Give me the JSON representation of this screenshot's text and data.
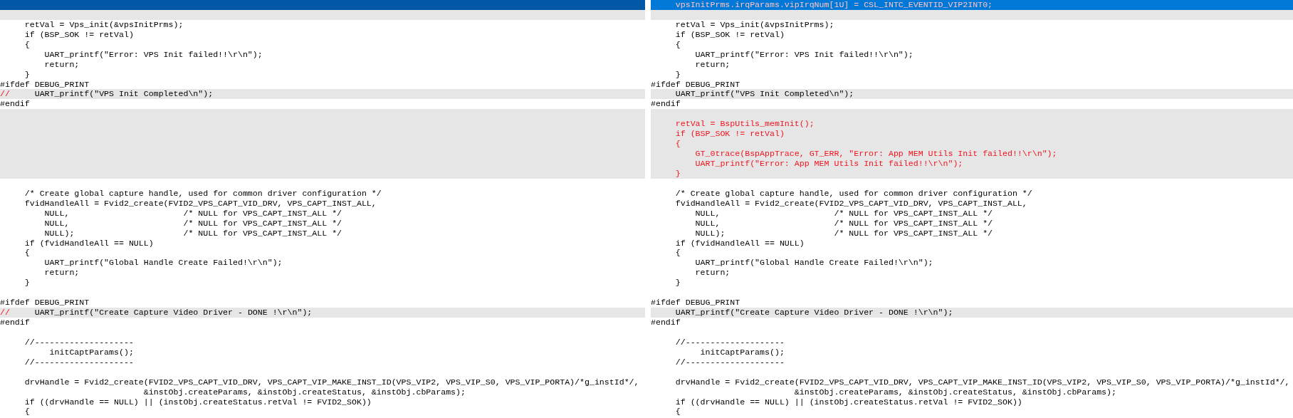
{
  "panes": [
    {
      "focused": false,
      "lines": [
        {
          "kind": "blank",
          "selected": true
        },
        {
          "kind": "blank",
          "selected": false
        },
        {
          "kind": "same",
          "selected": false,
          "text": "     retVal = Vps_init(&vpsInitPrms);"
        },
        {
          "kind": "same",
          "selected": false,
          "text": "     if (BSP_SOK != retVal)"
        },
        {
          "kind": "same",
          "selected": false,
          "text": "     {"
        },
        {
          "kind": "same",
          "selected": false,
          "text": "         UART_printf(\"Error: VPS Init failed!!\\r\\n\");"
        },
        {
          "kind": "same",
          "selected": false,
          "text": "         return;"
        },
        {
          "kind": "same",
          "selected": false,
          "text": "     }"
        },
        {
          "kind": "same",
          "selected": false,
          "text": "#ifdef DEBUG_PRINT"
        },
        {
          "kind": "changed",
          "selected": false,
          "prefix": "//",
          "text": "     UART_printf(\"VPS Init Completed\\n\");"
        },
        {
          "kind": "same",
          "selected": false,
          "text": "#endif"
        },
        {
          "kind": "blank",
          "selected": false
        },
        {
          "kind": "blank",
          "selected": false
        },
        {
          "kind": "blank",
          "selected": false
        },
        {
          "kind": "blank",
          "selected": false
        },
        {
          "kind": "blank",
          "selected": false
        },
        {
          "kind": "blank",
          "selected": false
        },
        {
          "kind": "blank",
          "selected": false
        },
        {
          "kind": "same",
          "selected": false
        },
        {
          "kind": "same",
          "selected": false,
          "text": "     /* Create global capture handle, used for common driver configuration */"
        },
        {
          "kind": "same",
          "selected": false,
          "text": "     fvidHandleAll = Fvid2_create(FVID2_VPS_CAPT_VID_DRV, VPS_CAPT_INST_ALL,"
        },
        {
          "kind": "same",
          "selected": false,
          "text": "         NULL,                       /* NULL for VPS_CAPT_INST_ALL */"
        },
        {
          "kind": "same",
          "selected": false,
          "text": "         NULL,                       /* NULL for VPS_CAPT_INST_ALL */"
        },
        {
          "kind": "same",
          "selected": false,
          "text": "         NULL);                      /* NULL for VPS_CAPT_INST_ALL */"
        },
        {
          "kind": "same",
          "selected": false,
          "text": "     if (fvidHandleAll == NULL)"
        },
        {
          "kind": "same",
          "selected": false,
          "text": "     {"
        },
        {
          "kind": "same",
          "selected": false,
          "text": "         UART_printf(\"Global Handle Create Failed!\\r\\n\");"
        },
        {
          "kind": "same",
          "selected": false,
          "text": "         return;"
        },
        {
          "kind": "same",
          "selected": false,
          "text": "     }"
        },
        {
          "kind": "same",
          "selected": false
        },
        {
          "kind": "same",
          "selected": false,
          "text": "#ifdef DEBUG_PRINT"
        },
        {
          "kind": "changed",
          "selected": false,
          "prefix": "//",
          "text": "     UART_printf(\"Create Capture Video Driver - DONE !\\r\\n\");"
        },
        {
          "kind": "same",
          "selected": false,
          "text": "#endif"
        },
        {
          "kind": "same",
          "selected": false
        },
        {
          "kind": "same",
          "selected": false,
          "text": "     //--------------------"
        },
        {
          "kind": "same",
          "selected": false,
          "text": "          initCaptParams();"
        },
        {
          "kind": "same",
          "selected": false,
          "text": "     //--------------------"
        },
        {
          "kind": "same",
          "selected": false
        },
        {
          "kind": "same",
          "selected": false,
          "text": "     drvHandle = Fvid2_create(FVID2_VPS_CAPT_VID_DRV, VPS_CAPT_VIP_MAKE_INST_ID(VPS_VIP2, VPS_VIP_S0, VPS_VIP_PORTA)/*g_instId*/,"
        },
        {
          "kind": "same",
          "selected": false,
          "text": "                             &instObj.createParams, &instObj.createStatus, &instObj.cbParams);"
        },
        {
          "kind": "same",
          "selected": false,
          "text": "     if ((drvHandle == NULL) || (instObj.createStatus.retVal != FVID2_SOK))"
        },
        {
          "kind": "same",
          "selected": false,
          "text": "     {"
        }
      ]
    },
    {
      "focused": true,
      "lines": [
        {
          "kind": "added",
          "selected": true,
          "text": "     vpsInitPrms.irqParams.vipIrqNum[1U] = CSL_INTC_EVENTID_VIP2INT0;"
        },
        {
          "kind": "blank",
          "selected": false
        },
        {
          "kind": "same",
          "selected": false,
          "text": "     retVal = Vps_init(&vpsInitPrms);"
        },
        {
          "kind": "same",
          "selected": false,
          "text": "     if (BSP_SOK != retVal)"
        },
        {
          "kind": "same",
          "selected": false,
          "text": "     {"
        },
        {
          "kind": "same",
          "selected": false,
          "text": "         UART_printf(\"Error: VPS Init failed!!\\r\\n\");"
        },
        {
          "kind": "same",
          "selected": false,
          "text": "         return;"
        },
        {
          "kind": "same",
          "selected": false,
          "text": "     }"
        },
        {
          "kind": "same",
          "selected": false,
          "text": "#ifdef DEBUG_PRINT"
        },
        {
          "kind": "changed",
          "selected": false,
          "text": "     UART_printf(\"VPS Init Completed\\n\");"
        },
        {
          "kind": "same",
          "selected": false,
          "text": "#endif"
        },
        {
          "kind": "blank",
          "selected": false
        },
        {
          "kind": "added",
          "selected": false,
          "text": "     retVal = BspUtils_memInit();"
        },
        {
          "kind": "added",
          "selected": false,
          "text": "     if (BSP_SOK != retVal)"
        },
        {
          "kind": "added",
          "selected": false,
          "text": "     {"
        },
        {
          "kind": "added",
          "selected": false,
          "text": "         GT_0trace(BspAppTrace, GT_ERR, \"Error: App MEM Utils Init failed!!\\r\\n\");"
        },
        {
          "kind": "added",
          "selected": false,
          "text": "         UART_printf(\"Error: App MEM Utils Init failed!!\\r\\n\");"
        },
        {
          "kind": "added",
          "selected": false,
          "text": "     }"
        },
        {
          "kind": "same",
          "selected": false
        },
        {
          "kind": "same",
          "selected": false,
          "text": "     /* Create global capture handle, used for common driver configuration */"
        },
        {
          "kind": "same",
          "selected": false,
          "text": "     fvidHandleAll = Fvid2_create(FVID2_VPS_CAPT_VID_DRV, VPS_CAPT_INST_ALL,"
        },
        {
          "kind": "same",
          "selected": false,
          "text": "         NULL,                       /* NULL for VPS_CAPT_INST_ALL */"
        },
        {
          "kind": "same",
          "selected": false,
          "text": "         NULL,                       /* NULL for VPS_CAPT_INST_ALL */"
        },
        {
          "kind": "same",
          "selected": false,
          "text": "         NULL);                      /* NULL for VPS_CAPT_INST_ALL */"
        },
        {
          "kind": "same",
          "selected": false,
          "text": "     if (fvidHandleAll == NULL)"
        },
        {
          "kind": "same",
          "selected": false,
          "text": "     {"
        },
        {
          "kind": "same",
          "selected": false,
          "text": "         UART_printf(\"Global Handle Create Failed!\\r\\n\");"
        },
        {
          "kind": "same",
          "selected": false,
          "text": "         return;"
        },
        {
          "kind": "same",
          "selected": false,
          "text": "     }"
        },
        {
          "kind": "same",
          "selected": false
        },
        {
          "kind": "same",
          "selected": false,
          "text": "#ifdef DEBUG_PRINT"
        },
        {
          "kind": "changed",
          "selected": false,
          "text": "     UART_printf(\"Create Capture Video Driver - DONE !\\r\\n\");"
        },
        {
          "kind": "same",
          "selected": false,
          "text": "#endif"
        },
        {
          "kind": "same",
          "selected": false
        },
        {
          "kind": "same",
          "selected": false,
          "text": "     //--------------------"
        },
        {
          "kind": "same",
          "selected": false,
          "text": "          initCaptParams();"
        },
        {
          "kind": "same",
          "selected": false,
          "text": "     //--------------------"
        },
        {
          "kind": "same",
          "selected": false
        },
        {
          "kind": "same",
          "selected": false,
          "text": "     drvHandle = Fvid2_create(FVID2_VPS_CAPT_VID_DRV, VPS_CAPT_VIP_MAKE_INST_ID(VPS_VIP2, VPS_VIP_S0, VPS_VIP_PORTA)/*g_instId*/,"
        },
        {
          "kind": "same",
          "selected": false,
          "text": "                             &instObj.createParams, &instObj.createStatus, &instObj.cbParams);"
        },
        {
          "kind": "same",
          "selected": false,
          "text": "     if ((drvHandle == NULL) || (instObj.createStatus.retVal != FVID2_SOK))"
        },
        {
          "kind": "same",
          "selected": false,
          "text": "     {"
        }
      ]
    }
  ]
}
